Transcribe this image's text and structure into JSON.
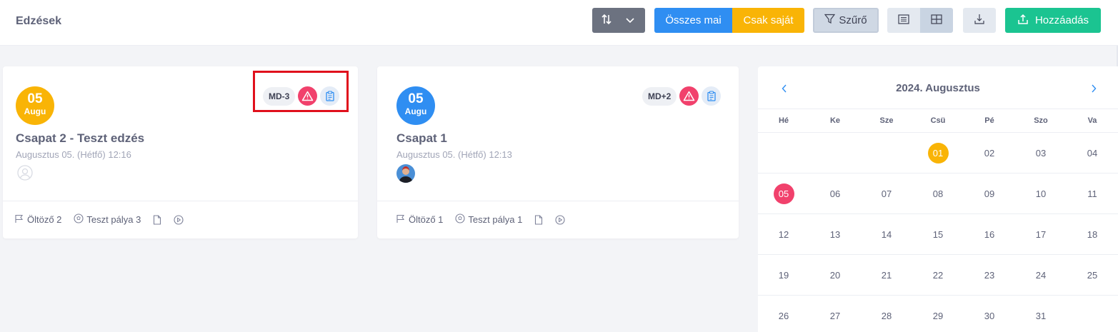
{
  "header": {
    "title": "Edzések",
    "all_today_label": "Összes mai",
    "own_only_label": "Csak saját",
    "filter_label": "Szűrő",
    "add_label": "Hozzáadás"
  },
  "colors": {
    "primary": "#2f8ef2",
    "warning": "#f9b406",
    "success": "#1bc491",
    "danger": "#f1416c"
  },
  "cards": [
    {
      "day": "05",
      "month": "Augu",
      "badge_color": "yellow",
      "title": "Csapat 2 - Teszt edzés",
      "subtitle": "Augusztus 05. (Hétfő) 12:16",
      "md_label": "MD-3",
      "icons": [
        "warning-icon",
        "clipboard-icon"
      ],
      "footer": {
        "locker": "Öltöző 2",
        "pitch": "Teszt pálya 3"
      }
    },
    {
      "day": "05",
      "month": "Augu",
      "badge_color": "blue",
      "title": "Csapat 1",
      "subtitle": "Augusztus 05. (Hétfő) 12:13",
      "md_label": "MD+2",
      "icons": [
        "warning-icon",
        "clipboard-icon"
      ],
      "footer": {
        "locker": "Öltöző 1",
        "pitch": "Teszt pálya 1"
      }
    }
  ],
  "calendar": {
    "title": "2024. Augusztus",
    "weekdays": [
      "Hé",
      "Ke",
      "Sze",
      "Csü",
      "Pé",
      "Szo",
      "Va"
    ],
    "weeks": [
      [
        "",
        "",
        "",
        "01",
        "02",
        "03",
        "04"
      ],
      [
        "05",
        "06",
        "07",
        "08",
        "09",
        "10",
        "11"
      ],
      [
        "12",
        "13",
        "14",
        "15",
        "16",
        "17",
        "18"
      ],
      [
        "19",
        "20",
        "21",
        "22",
        "23",
        "24",
        "25"
      ],
      [
        "26",
        "27",
        "28",
        "29",
        "30",
        "31",
        ""
      ]
    ],
    "today": "01",
    "selected": "05"
  }
}
